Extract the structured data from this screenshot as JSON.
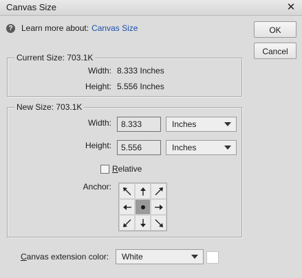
{
  "window": {
    "title": "Canvas Size",
    "close_glyph": "✕"
  },
  "help": {
    "icon": "question-circle-icon",
    "icon_glyph": "?",
    "prefix": "Learn more about:",
    "link": "Canvas Size"
  },
  "buttons": {
    "ok": "OK",
    "cancel": "Cancel"
  },
  "current_size": {
    "title": "Current Size: 703.1K",
    "width_label": "Width:",
    "width_value": "8.333 Inches",
    "height_label": "Height:",
    "height_value": "5.556 Inches"
  },
  "new_size": {
    "title": "New Size: 703.1K",
    "width_label": "Width:",
    "width_value": "8.333",
    "width_unit": "Inches",
    "height_label": "Height:",
    "height_value": "5.556",
    "height_unit": "Inches",
    "relative_label_first": "R",
    "relative_label_rest": "elative",
    "relative_checked": false,
    "anchor_label": "Anchor:",
    "anchor_arrows": [
      "arrow-up-left",
      "arrow-up",
      "arrow-up-right",
      "arrow-left",
      "anchor-dot",
      "arrow-right",
      "arrow-down-left",
      "arrow-down",
      "arrow-down-right"
    ]
  },
  "extension": {
    "label_first": "C",
    "label_rest": "anvas extension color:",
    "value": "White",
    "swatch_color": "#ffffff"
  }
}
